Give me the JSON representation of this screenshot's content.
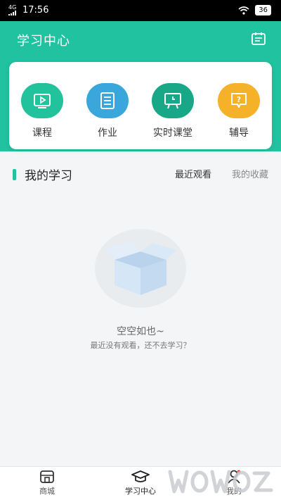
{
  "status": {
    "network": "4G",
    "time": "17:56",
    "battery": "36"
  },
  "header": {
    "title": "学习中心"
  },
  "shortcuts": [
    {
      "label": "课程",
      "icon": "video-icon",
      "color": "#22c29d"
    },
    {
      "label": "作业",
      "icon": "document-icon",
      "color": "#3aa7dc"
    },
    {
      "label": "实时课堂",
      "icon": "board-icon",
      "color": "#19a887"
    },
    {
      "label": "辅导",
      "icon": "question-icon",
      "color": "#f5b228"
    }
  ],
  "section": {
    "title": "我的学习",
    "tab_recent": "最近观看",
    "tab_favorites": "我的收藏"
  },
  "empty": {
    "title": "空空如也~",
    "subtitle": "最近没有观看，还不去学习？"
  },
  "tabbar": [
    {
      "label": "商城"
    },
    {
      "label": "学习中心"
    },
    {
      "label": "我的"
    }
  ]
}
